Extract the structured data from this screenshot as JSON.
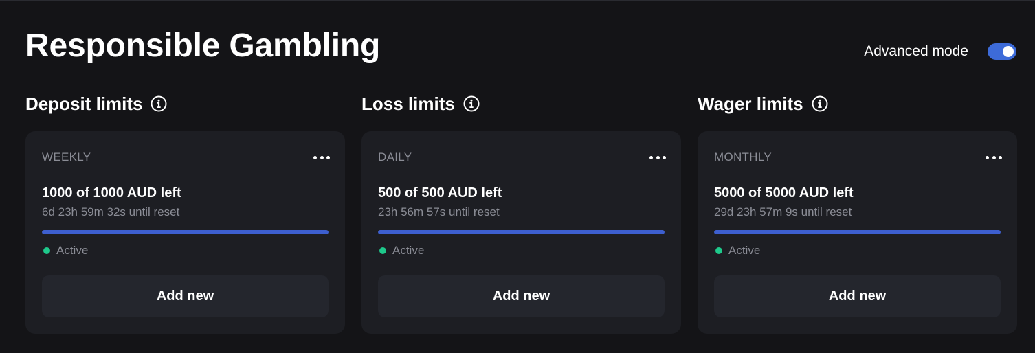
{
  "page": {
    "title": "Responsible Gambling"
  },
  "advanced_mode": {
    "label": "Advanced mode",
    "enabled": true,
    "accent": "#3d6bd9"
  },
  "sections": [
    {
      "title": "Deposit limits",
      "info_icon": "info-icon",
      "card": {
        "period": "WEEKLY",
        "amount_text": "1000 of 1000 AUD left",
        "reset_text": "6d 23h 59m 32s until reset",
        "progress_fraction": 1.0,
        "status": "Active",
        "button_label": "Add new"
      }
    },
    {
      "title": "Loss limits",
      "info_icon": "info-icon",
      "card": {
        "period": "DAILY",
        "amount_text": "500 of 500 AUD left",
        "reset_text": "23h 56m 57s until reset",
        "progress_fraction": 1.0,
        "status": "Active",
        "button_label": "Add new"
      }
    },
    {
      "title": "Wager limits",
      "info_icon": "info-icon",
      "card": {
        "period": "MONTHLY",
        "amount_text": "5000 of 5000 AUD left",
        "reset_text": "29d 23h 57m 9s until reset",
        "progress_fraction": 1.0,
        "status": "Active",
        "button_label": "Add new"
      }
    }
  ],
  "colors": {
    "background": "#141417",
    "card": "#1d1e23",
    "progress": "#3d5fcf",
    "status_active": "#1ec98b",
    "muted_text": "#8b8d96"
  }
}
